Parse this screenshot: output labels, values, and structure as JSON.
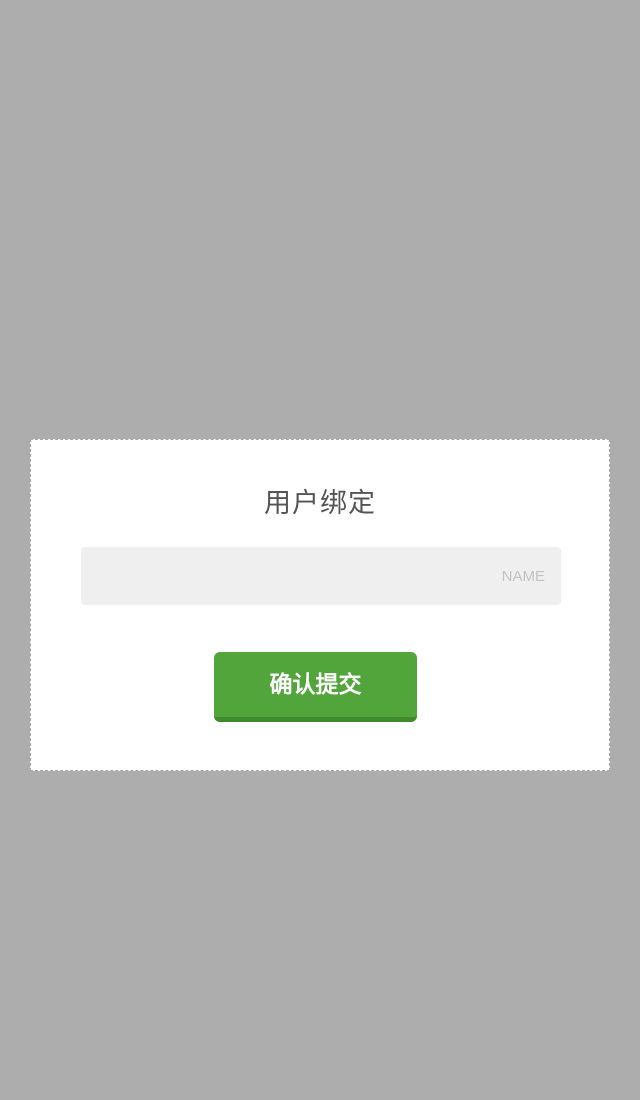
{
  "dialog": {
    "title": "用户绑定",
    "name_input": {
      "value": "",
      "placeholder": "NAME"
    },
    "submit_label": "确认提交"
  },
  "colors": {
    "overlay": "#adadad",
    "dialog_bg": "#ffffff",
    "input_bg": "#efefef",
    "button_bg": "#52a53a",
    "button_shadow": "#3f8a2c",
    "title_text": "#555555"
  }
}
